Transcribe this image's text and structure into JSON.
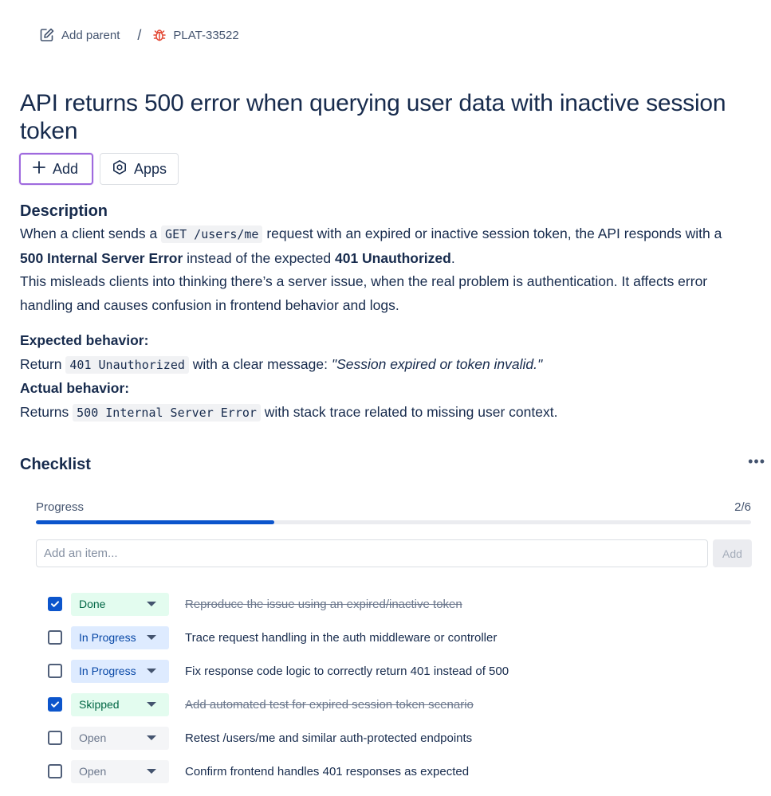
{
  "breadcrumb": {
    "add_parent_label": "Add parent",
    "separator": "/",
    "issue_key": "PLAT-33522"
  },
  "issue": {
    "title": "API returns 500 error when querying user data with inactive session token"
  },
  "actions": {
    "add_label": "Add",
    "apps_label": "Apps"
  },
  "description": {
    "heading": "Description",
    "p1_a": "When a client sends a ",
    "p1_code": "GET /users/me",
    "p1_b": " request with an expired or inactive session token, the API responds with a ",
    "p1_bold1": "500 Internal Server Error",
    "p1_c": " instead of the expected ",
    "p1_bold2": "401 Unauthorized",
    "p1_d": ".",
    "p2": "This misleads clients into thinking there’s a server issue, when the real problem is authentication. It affects error handling and causes confusion in frontend behavior and logs.",
    "expected_heading": "Expected behavior:",
    "expected_a": "Return ",
    "expected_code": "401 Unauthorized",
    "expected_b": " with a clear message: ",
    "expected_quote": "\"Session expired or token invalid.\"",
    "actual_heading": "Actual behavior:",
    "actual_a": "Returns ",
    "actual_code": "500 Internal Server Error",
    "actual_b": " with stack trace related to missing user context."
  },
  "checklist": {
    "title": "Checklist",
    "more_label": "•••",
    "progress_label": "Progress",
    "progress_count": "2/6",
    "progress_fraction": 0.3333,
    "add_placeholder": "Add an item...",
    "add_button_label": "Add",
    "items": [
      {
        "checked": true,
        "status": "Done",
        "status_kind": "done",
        "text": "Reproduce the issue using an expired/inactive token",
        "struck": true
      },
      {
        "checked": false,
        "status": "In Progress",
        "status_kind": "inprogress",
        "text": "Trace request handling in the auth middleware or controller",
        "struck": false
      },
      {
        "checked": false,
        "status": "In Progress",
        "status_kind": "inprogress",
        "text": "Fix response code logic to correctly return 401 instead of 500",
        "struck": false
      },
      {
        "checked": true,
        "status": "Skipped",
        "status_kind": "skipped",
        "text": "Add automated test for expired session token scenario",
        "struck": true
      },
      {
        "checked": false,
        "status": "Open",
        "status_kind": "open",
        "text": "Retest /users/me and similar auth-protected endpoints",
        "struck": false
      },
      {
        "checked": false,
        "status": "Open",
        "status_kind": "open",
        "text": "Confirm frontend handles 401 responses as expected",
        "struck": false
      }
    ]
  },
  "colors": {
    "accent": "#0c55cc",
    "focus_outline": "#9f6ade",
    "bug_icon": "#e34935"
  }
}
